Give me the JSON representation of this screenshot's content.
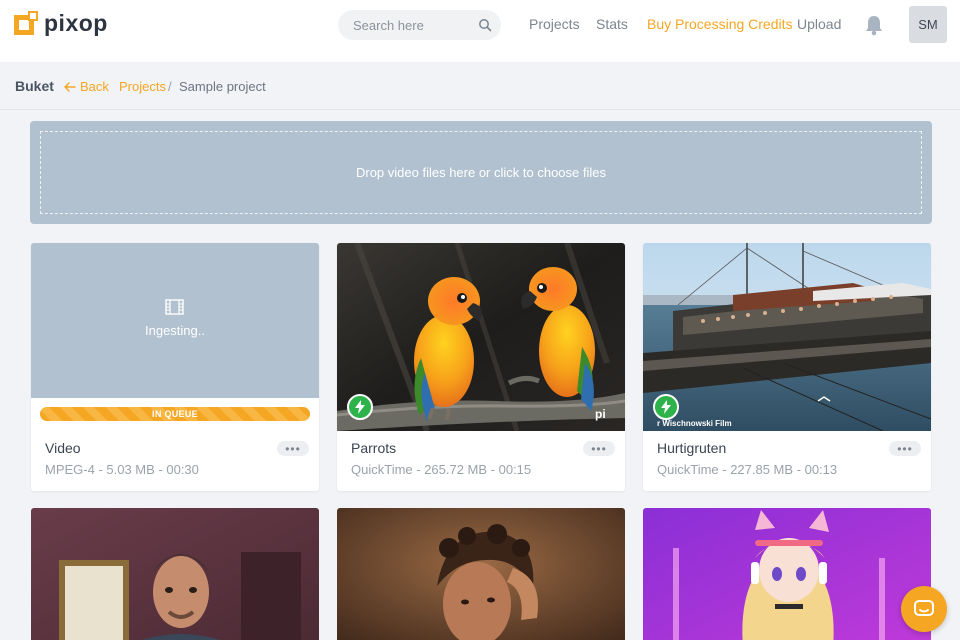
{
  "brand": {
    "name": "pixop",
    "accent": "#f5a623"
  },
  "header": {
    "search": {
      "placeholder": "Search here"
    },
    "nav": {
      "projects": "Projects",
      "stats": "Stats",
      "buy_credits": "Buy Processing Credits",
      "upload": "Upload"
    },
    "avatar_initials": "SM"
  },
  "breadcrumb": {
    "title": "Buket",
    "back": "Back",
    "projects": "Projects",
    "separator": "/",
    "current": "Sample project"
  },
  "dropzone": {
    "text": "Drop video files here or click to choose files"
  },
  "videos": [
    {
      "title": "Video",
      "meta": "MPEG-4 - 5.03 MB - 00:30",
      "status": "Ingesting..",
      "queue_label": "IN QUEUE",
      "more": "•••"
    },
    {
      "title": "Parrots",
      "meta": "QuickTime - 265.72 MB - 00:15",
      "more": "•••",
      "watermark": "pi"
    },
    {
      "title": "Hurtigruten",
      "meta": "QuickTime - 227.85 MB - 00:13",
      "more": "•••",
      "watermark": "r Wischnowski Film"
    }
  ],
  "icons": [
    "search-icon",
    "bell-icon",
    "back-arrow-icon",
    "film-icon",
    "bolt-icon",
    "more-icon",
    "chat-icon"
  ]
}
